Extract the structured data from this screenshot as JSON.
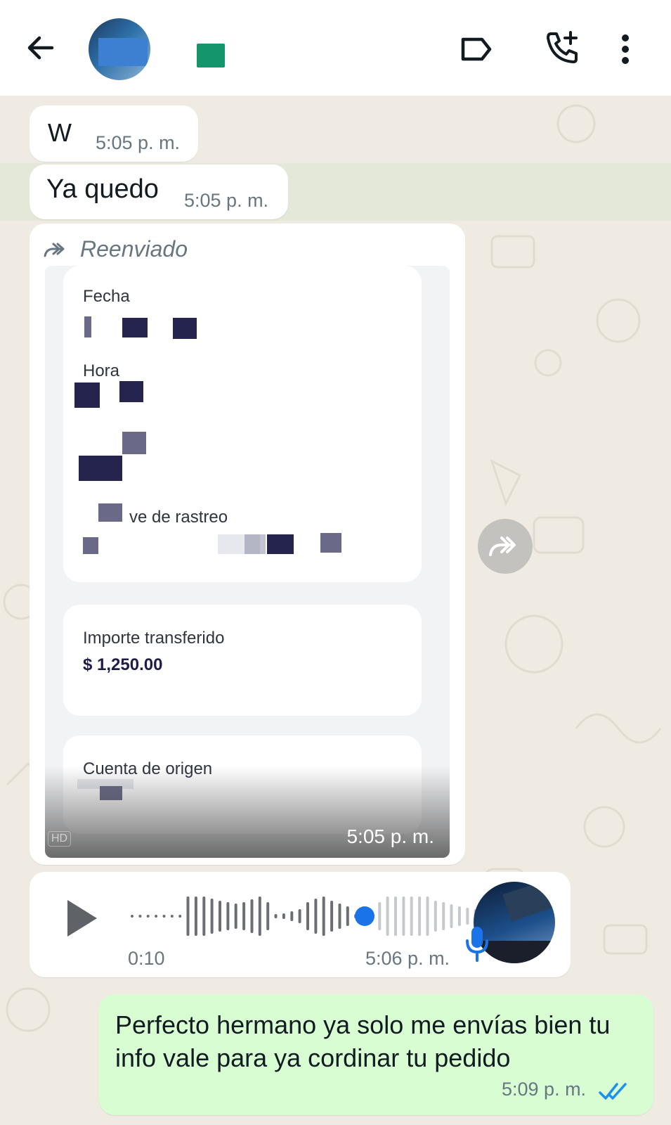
{
  "header": {
    "icons": [
      "back-arrow-icon",
      "label-icon",
      "add-call-icon",
      "more-vert-icon"
    ]
  },
  "messages": {
    "m1": {
      "text": "W",
      "time": "5:05 p. m."
    },
    "m2": {
      "text": "Ya quedo",
      "time": "5:05 p. m."
    },
    "forwarded": {
      "label": "Reenviado",
      "image": {
        "fecha_label": "Fecha",
        "hora_label": "Hora",
        "rastreo_label": "ve de rastreo",
        "importe_label": "Importe transferido",
        "importe_value": "$ 1,250.00",
        "cuenta_label": "Cuenta de origen",
        "hd": "HD"
      },
      "time": "5:05 p. m."
    },
    "voice": {
      "duration": "0:10",
      "time": "5:06 p. m.",
      "progress": 0.67
    },
    "outgoing": {
      "text": "Perfecto hermano ya solo me envías bien tu info vale para ya cordinar tu pedido",
      "time": "5:09 p. m.",
      "status": "read"
    }
  },
  "colors": {
    "outgoing_bubble": "#d9fdd3",
    "incoming_bubble": "#ffffff",
    "wallpaper": "#efeae2",
    "read_ticks": "#53bdeb",
    "voice_progress": "#1a73e8"
  }
}
